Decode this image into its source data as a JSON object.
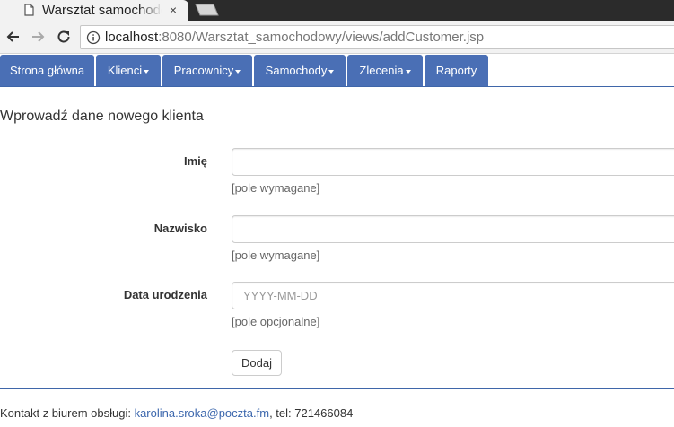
{
  "browser": {
    "tab_title": "Warsztat samochodowy",
    "url_host": "localhost",
    "url_rest": ":8080/Warsztat_samochodowy/views/addCustomer.jsp",
    "tab_close_glyph": "×"
  },
  "navbar": {
    "items": [
      {
        "label": "Strona główna",
        "dropdown": false
      },
      {
        "label": "Klienci",
        "dropdown": true
      },
      {
        "label": "Pracownicy",
        "dropdown": true
      },
      {
        "label": "Samochody",
        "dropdown": true
      },
      {
        "label": "Zlecenia",
        "dropdown": true
      },
      {
        "label": "Raporty",
        "dropdown": false
      }
    ],
    "color": "#4a6fb5"
  },
  "form": {
    "title": "Wprowadź dane nowego klienta",
    "fields": [
      {
        "label": "Imię",
        "value": "",
        "placeholder": "",
        "help": "[pole wymagane]"
      },
      {
        "label": "Nazwisko",
        "value": "",
        "placeholder": "",
        "help": "[pole wymagane]"
      },
      {
        "label": "Data urodzenia",
        "value": "",
        "placeholder": "YYYY-MM-DD",
        "help": "[pole opcjonalne]"
      }
    ],
    "submit_label": "Dodaj"
  },
  "footer": {
    "prefix": "Kontakt z biurem obsługi: ",
    "email": "karolina.sroka@poczta.fm",
    "suffix": ", tel: 721466084",
    "link_color": "#3c67ad"
  },
  "icons": {
    "tab": "page-icon",
    "back": "back-arrow-icon",
    "forward": "forward-arrow-icon",
    "reload": "reload-icon",
    "info": "info-icon",
    "caret": "caret-down-icon"
  }
}
